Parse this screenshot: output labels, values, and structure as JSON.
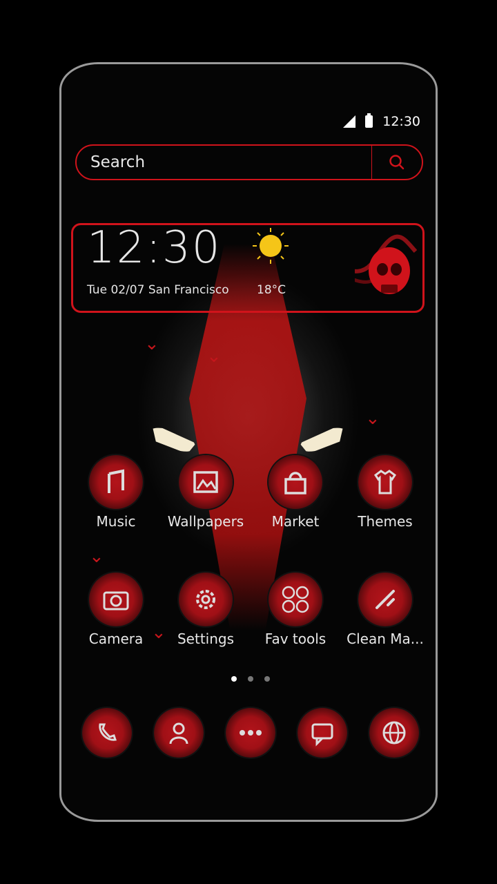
{
  "status_bar": {
    "time": "12:30"
  },
  "search": {
    "placeholder": "Search"
  },
  "widget": {
    "time": "12:30",
    "date": "Tue  02/07  San Francisco",
    "temperature": "18°C",
    "weather_icon": "sun-icon"
  },
  "apps": [
    {
      "label": "Music",
      "icon": "music-icon"
    },
    {
      "label": "Wallpapers",
      "icon": "wallpapers-icon"
    },
    {
      "label": "Market",
      "icon": "market-icon"
    },
    {
      "label": "Themes",
      "icon": "themes-icon"
    },
    {
      "label": "Camera",
      "icon": "camera-icon"
    },
    {
      "label": "Settings",
      "icon": "settings-icon"
    },
    {
      "label": "Fav tools",
      "icon": "fav-tools-icon"
    },
    {
      "label": "Clean Ma...",
      "icon": "clean-master-icon"
    }
  ],
  "page_indicator": {
    "count": 3,
    "active": 0
  },
  "dock": [
    {
      "icon": "phone-icon"
    },
    {
      "icon": "contacts-icon"
    },
    {
      "icon": "app-drawer-icon"
    },
    {
      "icon": "messages-icon"
    },
    {
      "icon": "browser-icon"
    }
  ],
  "colors": {
    "accent": "#d0131b",
    "background": "#000000",
    "frame": "#9a9a9a"
  }
}
